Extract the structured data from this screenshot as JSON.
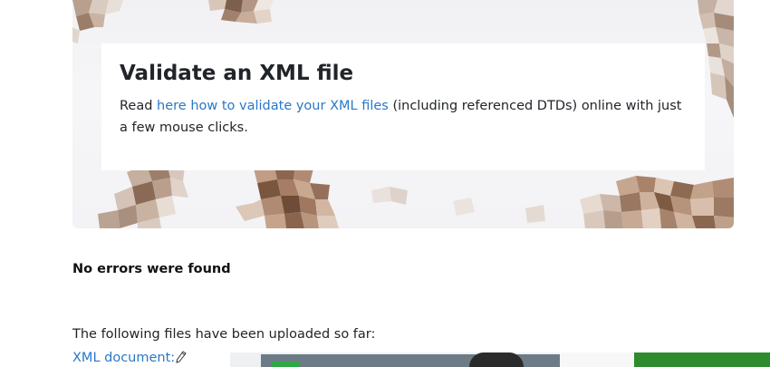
{
  "hero": {
    "title": "Validate an XML file",
    "text_before": "Read ",
    "link_text": "here how to validate your XML files",
    "text_after": " (including referenced DTDs) online with just a few mouse clicks."
  },
  "status": {
    "message": "No errors were found"
  },
  "uploads": {
    "intro": "The following files have been uploaded so far:",
    "xml_document_label": "XML document:",
    "edit_icon": "pencil-icon"
  },
  "colors": {
    "link": "#2a78c8",
    "text": "#212529",
    "hero_background": "#f3f2f5"
  }
}
